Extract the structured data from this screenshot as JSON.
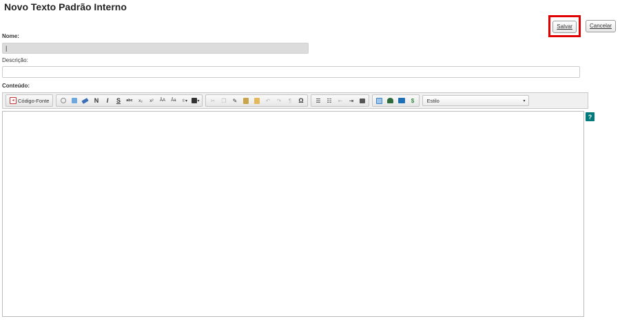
{
  "header": {
    "title": "Novo Texto Padrão Interno"
  },
  "actions": {
    "save_label": "Salvar",
    "cancel_label": "Cancelar"
  },
  "form": {
    "name_label": "Nome:",
    "name_value": "|",
    "description_label": "Descrição:",
    "description_value": "",
    "content_label": "Conteúdo:"
  },
  "toolbar": {
    "source_label": "Código-Fonte",
    "bold_label": "N",
    "italic_label": "I",
    "strike_label": "S",
    "smallcaps_label": "abc",
    "subscript_label": "x₂",
    "superscript_label": "x²",
    "style_label": "Estilo",
    "special_char_label": "Ω",
    "paragraph_label": "¶",
    "dollar_label": "$"
  },
  "help": {
    "label": "?"
  },
  "colors": {
    "highlight": "#e00000",
    "help_bg": "#007a7a",
    "name_field_bg": "#dcdcdc"
  }
}
